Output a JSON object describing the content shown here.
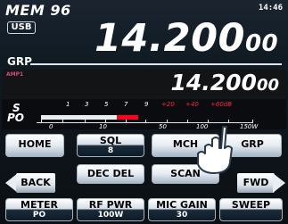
{
  "header": {
    "memory": "MEM 96",
    "time": "14:46"
  },
  "vfo": {
    "mode": "USB",
    "main_freq_big": "14.200",
    "main_freq_small": "00",
    "group": "GRP",
    "amp": "AMP1",
    "sub_freq_big": "14.200",
    "sub_freq_small": "00"
  },
  "meter": {
    "s_label": "S",
    "po_label": "PO",
    "s_ticks": [
      "1",
      "3",
      "5",
      "7",
      "9",
      "+20",
      "+40",
      "+60dB"
    ],
    "po_ticks": [
      "0",
      "10",
      "50",
      "100",
      "150W"
    ],
    "signal_level": 0.36,
    "peak_start": 0.36,
    "peak_end": 0.46
  },
  "buttons": {
    "row1": [
      {
        "label": "HOME",
        "sub": ""
      },
      {
        "label": "SQL",
        "sub": "8"
      },
      {
        "label": "MCH",
        "sub": ""
      },
      {
        "label": "GRP",
        "sub": ""
      }
    ],
    "row2": [
      {
        "label": "BACK"
      },
      {
        "label": "DEC DEL"
      },
      {
        "label": "SCAN"
      },
      {
        "label": "FWD"
      }
    ],
    "row3": [
      {
        "label": "METER",
        "sub": "PO"
      },
      {
        "label": "RF PWR",
        "sub": "100W"
      },
      {
        "label": "MIC GAIN",
        "sub": "30"
      },
      {
        "label": "SWEEP",
        "sub": ""
      }
    ]
  },
  "colors": {
    "accent_red": "#ff001f",
    "amp_pink": "#d34c7c"
  }
}
